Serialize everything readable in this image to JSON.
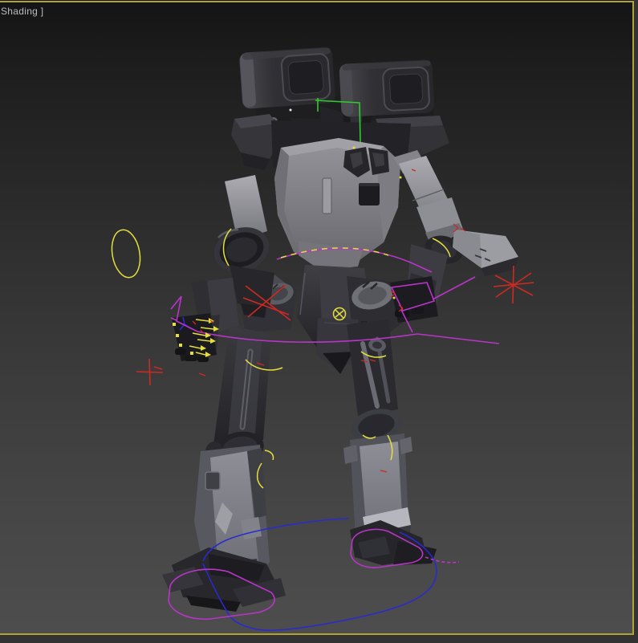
{
  "viewport": {
    "label": "Shading ]",
    "border_color": "#b1a236",
    "background_top": "#141414",
    "background_bottom": "#4e4e4e"
  },
  "rig": {
    "colors": {
      "yellow": "#e4de3e",
      "magenta": "#b935c9",
      "red": "#cd2a22",
      "blue": "#2a2ace",
      "green": "#2ecc2e",
      "white": "#e9e9e9"
    },
    "controls": [
      {
        "name": "selection-outline-green",
        "color": "green"
      },
      {
        "name": "ellipse-control-left",
        "color": "yellow"
      },
      {
        "name": "chest-band-control",
        "color": "magenta"
      },
      {
        "name": "chest-dashed-arc",
        "color": "yellow"
      },
      {
        "name": "waist-band-control",
        "color": "magenta"
      },
      {
        "name": "hand-control-right",
        "color": "magenta"
      },
      {
        "name": "hip-cross-control",
        "color": "red"
      },
      {
        "name": "star-control-right",
        "color": "red"
      },
      {
        "name": "plus-control-left",
        "color": "red"
      },
      {
        "name": "gizmo-circle-control",
        "color": "yellow"
      },
      {
        "name": "shoulder-arc-left",
        "color": "yellow"
      },
      {
        "name": "shoulder-arc-right",
        "color": "yellow"
      },
      {
        "name": "thigh-arc-left",
        "color": "yellow"
      },
      {
        "name": "thigh-arc-right",
        "color": "yellow"
      },
      {
        "name": "knee-arcs-left",
        "color": "yellow"
      },
      {
        "name": "knee-arcs-right",
        "color": "yellow"
      },
      {
        "name": "finger-arrow-controls",
        "color": "yellow"
      },
      {
        "name": "foot-control-left",
        "color": "magenta"
      },
      {
        "name": "foot-control-right",
        "color": "magenta"
      },
      {
        "name": "ground-loop-control",
        "color": "blue"
      }
    ]
  }
}
